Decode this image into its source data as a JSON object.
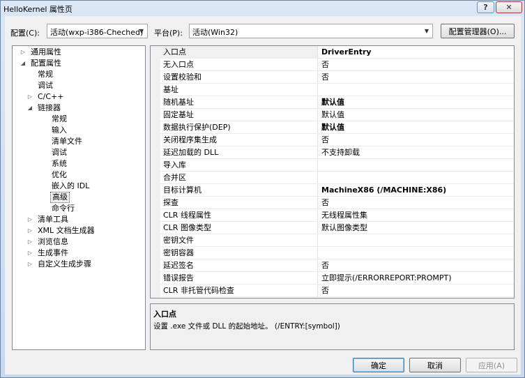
{
  "window": {
    "title": "HelloKernel 属性页",
    "help_label": "?",
    "close_label": "✕"
  },
  "toolbar": {
    "config_label": "配置(C):",
    "config_value": "活动(wxp-i386-Cheched)",
    "platform_label": "平台(P):",
    "platform_value": "活动(Win32)",
    "config_manager_label": "配置管理器(O)..."
  },
  "tree": {
    "items": [
      {
        "label": "通用属性",
        "level": 0,
        "expander": "collapsed"
      },
      {
        "label": "配置属性",
        "level": 0,
        "expander": "expanded"
      },
      {
        "label": "常规",
        "level": 1,
        "expander": "none"
      },
      {
        "label": "调试",
        "level": 1,
        "expander": "none"
      },
      {
        "label": "C/C++",
        "level": 1,
        "expander": "collapsed"
      },
      {
        "label": "链接器",
        "level": 1,
        "expander": "expanded"
      },
      {
        "label": "常规",
        "level": 2,
        "expander": "none"
      },
      {
        "label": "输入",
        "level": 2,
        "expander": "none"
      },
      {
        "label": "清单文件",
        "level": 2,
        "expander": "none"
      },
      {
        "label": "调试",
        "level": 2,
        "expander": "none"
      },
      {
        "label": "系统",
        "level": 2,
        "expander": "none"
      },
      {
        "label": "优化",
        "level": 2,
        "expander": "none"
      },
      {
        "label": "嵌入的 IDL",
        "level": 2,
        "expander": "none"
      },
      {
        "label": "高级",
        "level": 2,
        "expander": "none",
        "selected": true
      },
      {
        "label": "命令行",
        "level": 2,
        "expander": "none"
      },
      {
        "label": "清单工具",
        "level": 1,
        "expander": "collapsed"
      },
      {
        "label": "XML 文档生成器",
        "level": 1,
        "expander": "collapsed"
      },
      {
        "label": "浏览信息",
        "level": 1,
        "expander": "collapsed"
      },
      {
        "label": "生成事件",
        "level": 1,
        "expander": "collapsed"
      },
      {
        "label": "自定义生成步骤",
        "level": 1,
        "expander": "collapsed"
      }
    ]
  },
  "properties": {
    "rows": [
      {
        "name": "入口点",
        "value": "DriverEntry",
        "bold": true,
        "selected": true
      },
      {
        "name": "无入口点",
        "value": "否",
        "bold": false
      },
      {
        "name": "设置校验和",
        "value": "否",
        "bold": false
      },
      {
        "name": "基址",
        "value": "",
        "bold": false
      },
      {
        "name": "随机基址",
        "value": "默认值",
        "bold": true
      },
      {
        "name": "固定基址",
        "value": "默认值",
        "bold": false
      },
      {
        "name": "数据执行保护(DEP)",
        "value": "默认值",
        "bold": true
      },
      {
        "name": "关闭程序集生成",
        "value": "否",
        "bold": false
      },
      {
        "name": "延迟加载的 DLL",
        "value": "不支持卸载",
        "bold": false
      },
      {
        "name": "导入库",
        "value": "",
        "bold": false
      },
      {
        "name": "合并区",
        "value": "",
        "bold": false
      },
      {
        "name": "目标计算机",
        "value": "MachineX86 (/MACHINE:X86)",
        "bold": true
      },
      {
        "name": "探查",
        "value": "否",
        "bold": false
      },
      {
        "name": "CLR 线程属性",
        "value": "无线程属性集",
        "bold": false
      },
      {
        "name": "CLR 图像类型",
        "value": "默认图像类型",
        "bold": false
      },
      {
        "name": "密钥文件",
        "value": "",
        "bold": false
      },
      {
        "name": "密钥容器",
        "value": "",
        "bold": false
      },
      {
        "name": "延迟签名",
        "value": "否",
        "bold": false
      },
      {
        "name": "错误报告",
        "value": "立即提示(/ERRORREPORT:PROMPT)",
        "bold": false
      },
      {
        "name": "CLR 非托管代码检查",
        "value": "否",
        "bold": false
      }
    ]
  },
  "description": {
    "title": "入口点",
    "text": "设置 .exe 文件或 DLL 的起始地址。     (/ENTRY:[symbol])"
  },
  "buttons": {
    "ok": "确定",
    "cancel": "取消",
    "apply": "应用(A)"
  }
}
